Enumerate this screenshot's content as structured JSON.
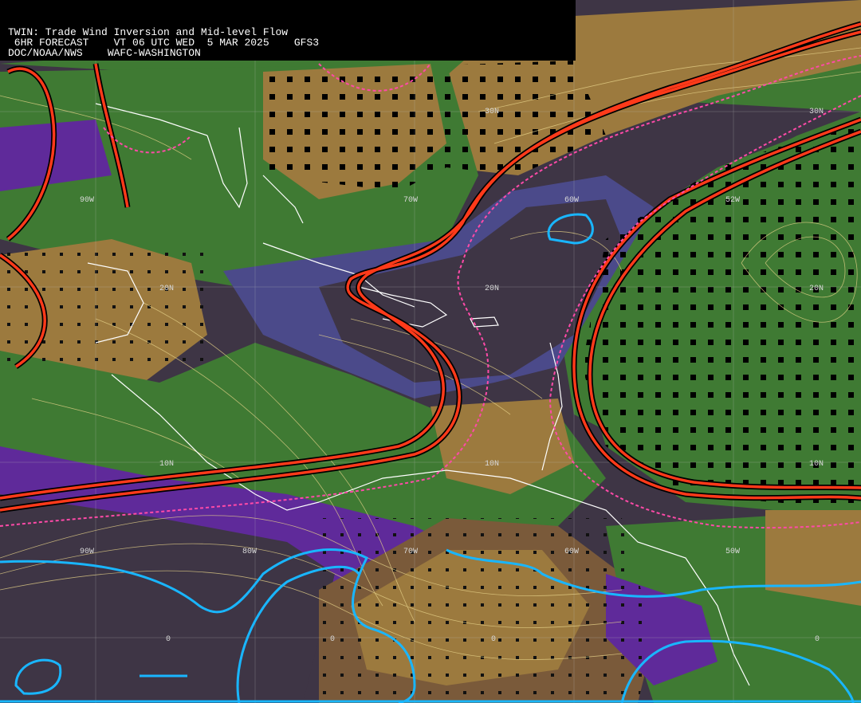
{
  "header": {
    "line1": "TWIN: Trade Wind Inversion and Mid-level Flow",
    "line2": " 6HR FORECAST    VT 06 UTC WED  5 MAR 2025    GFS3",
    "line3": "DOC/NOAA/NWS    WAFC-WASHINGTON"
  },
  "grid_labels": {
    "lat": [
      "30N",
      "30N",
      "20N",
      "20N",
      "20N",
      "10N",
      "10N",
      "10N"
    ],
    "lon": [
      "90W",
      "70W",
      "60W",
      "52W",
      "90W",
      "80W",
      "70W",
      "60W",
      "50W"
    ],
    "equator": [
      "0",
      "0",
      "0",
      "0"
    ]
  },
  "colors": {
    "green": "#3f7a33",
    "tan": "#9c7a3e",
    "brown": "#7a5a3a",
    "purple": "#5f2a9a",
    "slate": "#4b4a8a",
    "dark": "#3e3545",
    "red_contour": "#ff3a1a",
    "pink_contour": "#ff4aa8",
    "cyan_contour": "#19b6ff",
    "coast": "#ffffff",
    "streamline": "#e8d48a"
  }
}
